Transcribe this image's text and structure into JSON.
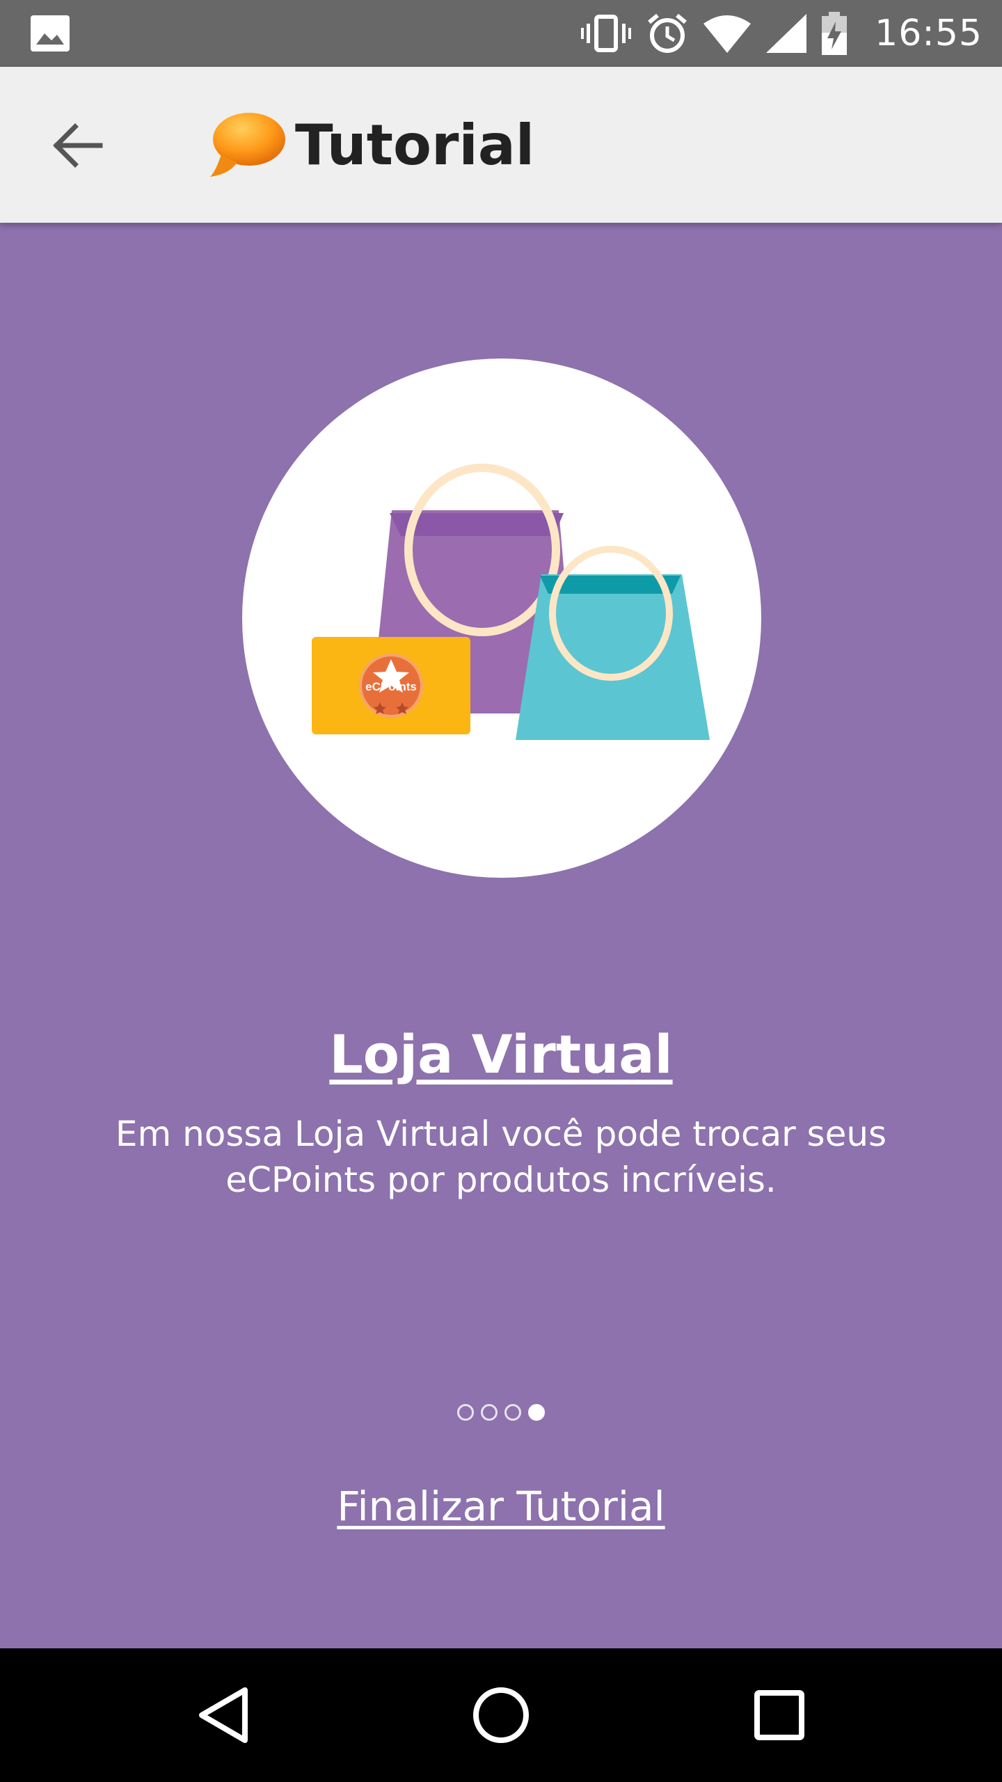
{
  "status_bar": {
    "time": "16:55",
    "icons": [
      "gallery-icon",
      "vibrate-icon",
      "alarm-icon",
      "wifi-icon",
      "signal-icon",
      "battery-charging-icon"
    ]
  },
  "app_bar": {
    "title": "Tutorial",
    "back_icon": "arrow-back-icon",
    "logo_icon": "speech-bubble-logo"
  },
  "slide": {
    "illustration": "shopping-bags-ecpoints-illustration",
    "badge_text": "eCPoints",
    "heading": "Loja Virtual",
    "description": "Em nossa Loja Virtual você pode trocar seus eCPoints por produtos incríveis."
  },
  "pager": {
    "total": 4,
    "current": 4
  },
  "finish_link": "Finalizar Tutorial",
  "nav_bar": {
    "icons": [
      "back-triangle-icon",
      "home-circle-icon",
      "recents-square-icon"
    ]
  },
  "colors": {
    "background": "#8d72ad",
    "status_bar": "#686868",
    "app_bar": "#efefef",
    "bag_purple": "#9b6cb0",
    "bag_teal": "#5bc6d1",
    "card_yellow": "#fbb614"
  }
}
